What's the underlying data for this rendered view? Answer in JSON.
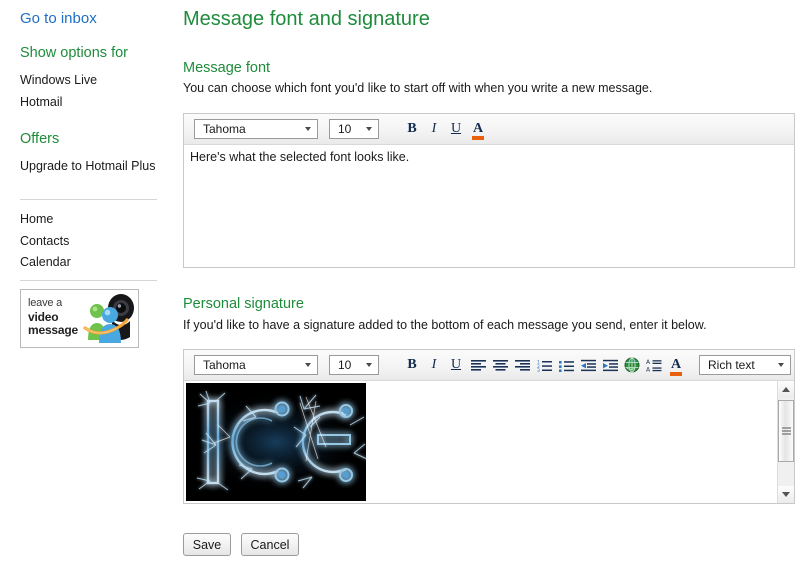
{
  "sidebar": {
    "inbox_link": "Go to inbox",
    "options_heading": "Show options for",
    "options_items": [
      "Windows Live",
      "Hotmail"
    ],
    "offers_heading": "Offers",
    "offers_items": [
      "Upgrade to Hotmail Plus"
    ],
    "nav_items": [
      "Home",
      "Contacts",
      "Calendar"
    ],
    "promo": {
      "line1": "leave a",
      "line2": "video",
      "line3": "message"
    }
  },
  "main": {
    "page_title": "Message font and signature",
    "message_font": {
      "heading": "Message font",
      "description": "You can choose which font you'd like to start off with when you write a new message.",
      "font_value": "Tahoma",
      "size_value": "10",
      "sample_text": "Here's what the selected font looks like.",
      "buttons": {
        "bold": "B",
        "italic": "I",
        "underline": "U",
        "font_color": "A"
      }
    },
    "personal_signature": {
      "heading": "Personal signature",
      "description": "If you'd like to have a signature added to the bottom of each message you send, enter it below.",
      "font_value": "Tahoma",
      "size_value": "10",
      "mode_value": "Rich text",
      "buttons": {
        "bold": "B",
        "italic": "I",
        "underline": "U",
        "font_color": "A",
        "highlight": "A"
      },
      "signature_image_text": "ICE"
    },
    "actions": {
      "save": "Save",
      "cancel": "Cancel"
    }
  },
  "colors": {
    "heading_green": "#1e8c3b",
    "link_blue": "#1f6fc4",
    "icon_navy": "#122b4e",
    "accent_orange": "#e8600b"
  }
}
